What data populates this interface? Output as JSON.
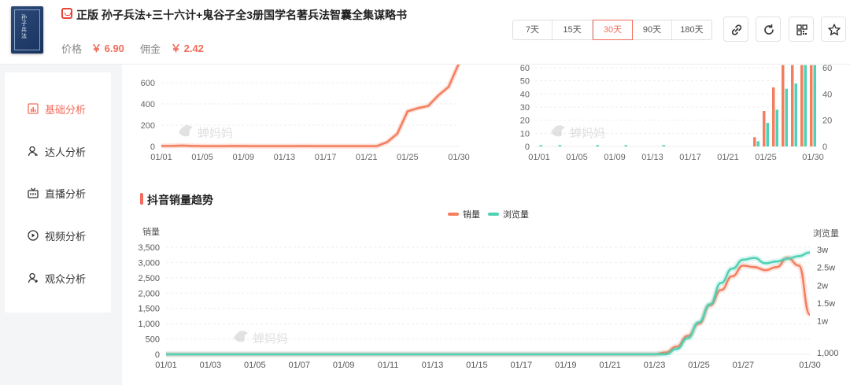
{
  "product": {
    "title": "正版 孙子兵法+三十六计+鬼谷子全3册国学名著兵法智囊全集谋略书",
    "cover_text": "孙子兵法",
    "price_label": "价格",
    "price": "￥ 6.90",
    "commission_label": "佣金",
    "commission": "￥ 2.42"
  },
  "periods": [
    {
      "label": "7天",
      "active": false
    },
    {
      "label": "15天",
      "active": false
    },
    {
      "label": "30天",
      "active": true
    },
    {
      "label": "90天",
      "active": false
    },
    {
      "label": "180天",
      "active": false
    }
  ],
  "toolbar_icons": [
    "link-icon",
    "refresh-icon",
    "qrcode-icon",
    "star-icon"
  ],
  "sidebar": {
    "items": [
      {
        "label": "基础分析",
        "icon": "chart-icon",
        "active": true
      },
      {
        "label": "达人分析",
        "icon": "person-icon",
        "active": false
      },
      {
        "label": "直播分析",
        "icon": "tv-icon",
        "active": false
      },
      {
        "label": "视频分析",
        "icon": "play-icon",
        "active": false
      },
      {
        "label": "观众分析",
        "icon": "audience-icon",
        "active": false
      }
    ]
  },
  "watermark": "蝉妈妈",
  "section": {
    "title": "抖音销量趋势"
  },
  "colors": {
    "accent": "#f36c5b",
    "sales": "#f47e5e",
    "views": "#4fd1b5"
  },
  "chart_data": [
    {
      "type": "line",
      "x_ticks": [
        "01/01",
        "01/05",
        "01/09",
        "01/13",
        "01/17",
        "01/21",
        "01/25",
        "01/30"
      ],
      "y_ticks": [
        "0",
        "200",
        "400",
        "600"
      ],
      "grid": true,
      "series": [
        {
          "color": "#f47e5e",
          "x": [
            1,
            2,
            3,
            4,
            5,
            6,
            7,
            8,
            9,
            10,
            11,
            12,
            13,
            14,
            15,
            16,
            17,
            18,
            19,
            20,
            21,
            22,
            23,
            24,
            25,
            26,
            27,
            28,
            29,
            30
          ],
          "values": [
            5,
            5,
            8,
            5,
            3,
            3,
            3,
            5,
            4,
            3,
            3,
            3,
            3,
            3,
            4,
            3,
            3,
            3,
            3,
            3,
            3,
            3,
            40,
            120,
            330,
            360,
            380,
            480,
            560,
            780
          ]
        }
      ]
    },
    {
      "type": "bar",
      "x_ticks": [
        "01/01",
        "01/05",
        "01/09",
        "01/13",
        "01/17",
        "01/21",
        "01/25",
        "01/30"
      ],
      "y_ticks": [
        "0",
        "10",
        "20",
        "30",
        "40",
        "50",
        "60"
      ],
      "y2_ticks": [
        "0",
        "20",
        "40",
        "60"
      ],
      "grid": true,
      "series": [
        {
          "color": "#f47e5e",
          "axis": "left",
          "x": [
            24,
            25,
            26,
            27,
            28,
            29,
            30
          ],
          "values": [
            7,
            27,
            45,
            62,
            62,
            62,
            62
          ]
        },
        {
          "color": "#4fd1b5",
          "axis": "right",
          "x": [
            1,
            3,
            7,
            10,
            14,
            24,
            25,
            26,
            27,
            28,
            29,
            30
          ],
          "values": [
            1,
            1,
            1,
            1,
            1,
            4,
            18,
            28,
            44,
            48,
            62,
            62
          ]
        }
      ]
    },
    {
      "type": "line",
      "x_ticks": [
        "01/01",
        "01/03",
        "01/05",
        "01/07",
        "01/09",
        "01/11",
        "01/13",
        "01/15",
        "01/17",
        "01/19",
        "01/21",
        "01/23",
        "01/25",
        "01/27",
        "01/30"
      ],
      "y_ticks": [
        "0",
        "500",
        "1,000",
        "1,500",
        "2,000",
        "2,500",
        "3,000",
        "3,500"
      ],
      "y2_ticks": [
        "1,000",
        "1w",
        "1.5w",
        "2w",
        "2.5w",
        "3w"
      ],
      "ylabel": "销量",
      "y2label": "浏览量",
      "legend_position": "top-center",
      "grid": true,
      "series": [
        {
          "name": "销量",
          "color": "#f47e5e",
          "x": [
            1,
            5,
            10,
            15,
            20,
            22,
            23,
            23.5,
            24,
            24.5,
            25,
            25.5,
            26,
            26.5,
            27,
            27.5,
            28,
            28.5,
            29,
            29.5,
            30
          ],
          "values": [
            0,
            0,
            0,
            0,
            0,
            0,
            0,
            60,
            250,
            600,
            1000,
            1600,
            2100,
            2550,
            2900,
            2850,
            2750,
            2850,
            3150,
            2900,
            1300
          ]
        },
        {
          "name": "浏览量",
          "color": "#4fd1b5",
          "x": [
            1,
            5,
            10,
            15,
            20,
            22,
            23,
            23.5,
            24,
            24.5,
            25,
            25.5,
            26,
            26.5,
            27,
            27.5,
            28,
            28.5,
            29,
            29.5,
            30
          ],
          "values": [
            0,
            0,
            0,
            0,
            0,
            0,
            0,
            0,
            1500,
            4500,
            9000,
            14000,
            20000,
            24000,
            26500,
            27000,
            25500,
            26000,
            26800,
            27500,
            28500
          ]
        }
      ]
    }
  ]
}
